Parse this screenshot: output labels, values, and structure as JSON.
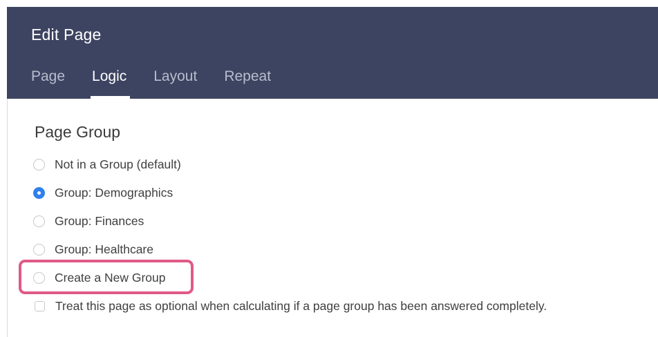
{
  "header": {
    "title": "Edit Page",
    "tabs": [
      {
        "label": "Page",
        "active": false
      },
      {
        "label": "Logic",
        "active": true
      },
      {
        "label": "Layout",
        "active": false
      },
      {
        "label": "Repeat",
        "active": false
      }
    ]
  },
  "page_group": {
    "title": "Page Group",
    "options": [
      {
        "label": "Not in a Group (default)",
        "selected": false
      },
      {
        "label": "Group: Demographics",
        "selected": true
      },
      {
        "label": "Group: Finances",
        "selected": false
      },
      {
        "label": "Group: Healthcare",
        "selected": false
      },
      {
        "label": "Create a New Group",
        "selected": false,
        "highlighted": true
      }
    ],
    "optional_checkbox": {
      "label": "Treat this page as optional when calculating if a page group has been answered completely.",
      "checked": false
    }
  },
  "colors": {
    "header_bg": "#3d4461",
    "radio_selected": "#2f80ed",
    "highlight_border": "#e05a86"
  }
}
